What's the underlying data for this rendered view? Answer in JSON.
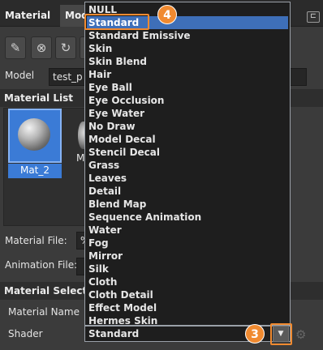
{
  "tabs": {
    "material": "Material",
    "model": "Model"
  },
  "pin_glyph": "⊏",
  "toolbar": {
    "buttons": [
      {
        "icon": "eyedropper-icon",
        "glyph": "✎"
      },
      {
        "icon": "clear-icon",
        "glyph": "⊗"
      },
      {
        "icon": "refresh-icon",
        "glyph": "↻"
      },
      {
        "icon": "save-icon",
        "glyph": "▣"
      }
    ]
  },
  "model": {
    "label": "Model",
    "value": "test_p"
  },
  "material_list": {
    "title": "Material List",
    "items": [
      {
        "name": "Mat_2"
      },
      {
        "name": "M"
      }
    ]
  },
  "material_file": {
    "label": "Material File:",
    "value": "%"
  },
  "animation_file": {
    "label": "Animation File:"
  },
  "material_select": {
    "title": "Material Select",
    "name_label": "Material Name",
    "shader_label": "Shader"
  },
  "shader": {
    "value": "Standard",
    "options": [
      "NULL",
      "Standard",
      "Standard Emissive",
      "Skin",
      "Skin Blend",
      "Hair",
      "Eye Ball",
      "Eye Occlusion",
      "Eye Water",
      "No Draw",
      "Model Decal",
      "Stencil Decal",
      "Grass",
      "Leaves",
      "Detail",
      "Blend Map",
      "Sequence Animation",
      "Water",
      "Fog",
      "Mirror",
      "Silk",
      "Cloth",
      "Cloth Detail",
      "Effect Model",
      "Hermes Skin"
    ],
    "selected_index": 1,
    "arrow_glyph": "▼"
  },
  "callouts": {
    "dropdown_button": "3",
    "standard_option": "4"
  },
  "colors": {
    "accent": "#3e6fb8",
    "callout": "#f08a30",
    "selection": "#3b7bd6"
  }
}
